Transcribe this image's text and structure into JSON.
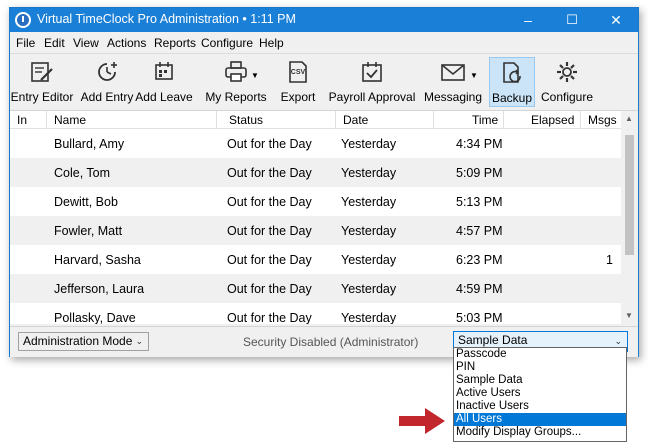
{
  "window": {
    "title": "Virtual TimeClock Pro Administration • 1:11 PM",
    "controls": {
      "minimize": "–",
      "maximize": "☐",
      "close": "✕"
    }
  },
  "menu": [
    "File",
    "Edit",
    "View",
    "Actions",
    "Reports",
    "Configure",
    "Help"
  ],
  "toolbar": {
    "entry_editor": "Entry Editor",
    "add_entry": "Add Entry",
    "add_leave": "Add Leave",
    "my_reports": "My Reports",
    "export": "Export",
    "export_badge": "CSV",
    "payroll_approval": "Payroll Approval",
    "messaging": "Messaging",
    "backup": "Backup",
    "configure": "Configure"
  },
  "columns": {
    "in": "In",
    "name": "Name",
    "status": "Status",
    "date": "Date",
    "time": "Time",
    "elapsed": "Elapsed",
    "msgs": "Msgs"
  },
  "rows": [
    {
      "name": "Bullard, Amy",
      "status": "Out for the Day",
      "date": "Yesterday",
      "time": "4:34 PM",
      "msgs": ""
    },
    {
      "name": "Cole, Tom",
      "status": "Out for the Day",
      "date": "Yesterday",
      "time": "5:09 PM",
      "msgs": ""
    },
    {
      "name": "Dewitt, Bob",
      "status": "Out for the Day",
      "date": "Yesterday",
      "time": "5:13 PM",
      "msgs": ""
    },
    {
      "name": "Fowler, Matt",
      "status": "Out for the Day",
      "date": "Yesterday",
      "time": "4:57 PM",
      "msgs": ""
    },
    {
      "name": "Harvard, Sasha",
      "status": "Out for the Day",
      "date": "Yesterday",
      "time": "6:23 PM",
      "msgs": "1"
    },
    {
      "name": "Jefferson, Laura",
      "status": "Out for the Day",
      "date": "Yesterday",
      "time": "4:59 PM",
      "msgs": ""
    },
    {
      "name": "Pollasky, Dave",
      "status": "Out for the Day",
      "date": "Yesterday",
      "time": "5:03 PM",
      "msgs": ""
    }
  ],
  "status": {
    "mode_value": "Administration Mode",
    "security_text": "Security Disabled (Administrator)",
    "group_value": "Sample Data"
  },
  "dropdown": {
    "options": [
      "Passcode",
      "PIN",
      "Sample Data",
      "Active Users",
      "Inactive Users",
      "All Users",
      "Modify Display Groups..."
    ],
    "selected_index": 5
  },
  "colors": {
    "titlebar": "#1a7fd6",
    "selection": "#0078d7",
    "pointer_arrow": "#c1272d"
  }
}
